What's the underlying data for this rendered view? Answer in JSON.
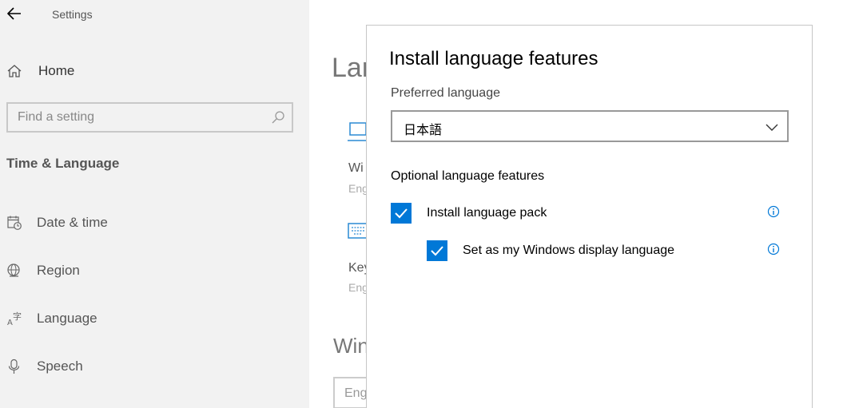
{
  "window": {
    "title": "Settings"
  },
  "sidebar": {
    "home_label": "Home",
    "search_placeholder": "Find a setting",
    "section_title": "Time & Language",
    "items": [
      {
        "label": "Date & time",
        "icon": "calendar-clock-icon"
      },
      {
        "label": "Region",
        "icon": "globe-icon"
      },
      {
        "label": "Language",
        "icon": "language-icon"
      },
      {
        "label": "Speech",
        "icon": "microphone-icon"
      }
    ]
  },
  "background": {
    "page_title": "Lan",
    "item1_title": "Wi",
    "item1_sub": "Eng",
    "item2_title": "Key",
    "item2_sub": "Eng",
    "section_heading": "Win",
    "select_value": "Eng"
  },
  "dialog": {
    "title": "Install language features",
    "preferred_label": "Preferred language",
    "preferred_value": "日本語",
    "optional_heading": "Optional language features",
    "options": [
      {
        "label": "Install language pack",
        "checked": true
      },
      {
        "label": "Set as my Windows display language",
        "checked": true
      }
    ]
  },
  "colors": {
    "accent": "#0078d7",
    "sidebar_bg": "#f2f2f2"
  }
}
